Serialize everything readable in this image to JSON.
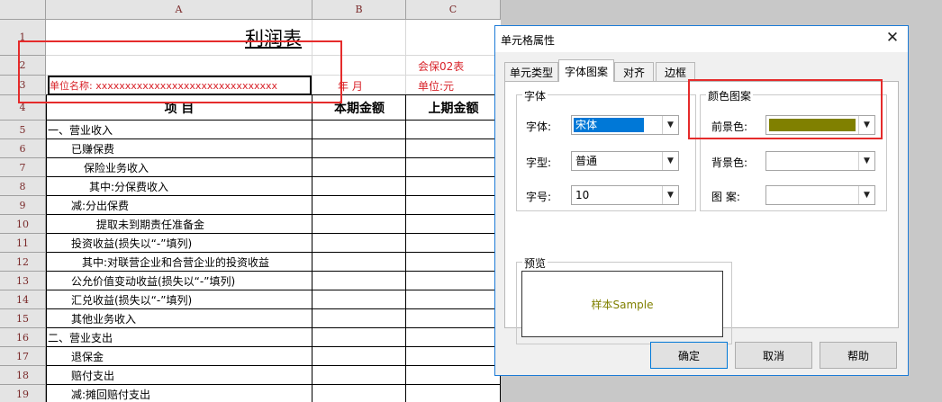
{
  "sheet": {
    "columns": [
      "A",
      "B",
      "C"
    ],
    "rows": [
      "1",
      "2",
      "3",
      "4",
      "5",
      "6",
      "7",
      "8",
      "9",
      "10",
      "11",
      "12",
      "13",
      "14",
      "15",
      "16",
      "17",
      "18",
      "19"
    ],
    "title": "利润表",
    "form_code": "会保02表",
    "unit_name": "单位名称: xxxxxxxxxxxxxxxxxxxxxxxxxxxxxxx",
    "year_month": "年    月",
    "unit": "单位:元",
    "header_item": "项            目",
    "header_current": "本期金额",
    "header_previous": "上期金额",
    "items": [
      "一、营业收入",
      "已赚保费",
      "保险业务收入",
      "其中:分保费收入",
      "减:分出保费",
      "提取未到期责任准备金",
      "投资收益(损失以“-”填列)",
      "其中:对联营企业和合营企业的投资收益",
      "公允价值变动收益(损失以“-”填列)",
      "汇兑收益(损失以“-”填列)",
      "其他业务收入",
      "二、营业支出",
      "退保金",
      "赔付支出",
      "减:摊回赔付支出"
    ]
  },
  "dialog": {
    "title": "单元格属性",
    "close_icon": "close-icon",
    "tabs": [
      "单元类型",
      "字体图案",
      "对齐",
      "边框"
    ],
    "active_tab": "字体图案",
    "font_group": {
      "label": "字体",
      "font_label": "字体:",
      "font_value": "宋体",
      "style_label": "字型:",
      "style_value": "普通",
      "size_label": "字号:",
      "size_value": "10"
    },
    "color_group": {
      "label": "颜色图案",
      "foreground_label": "前景色:",
      "foreground_color": "#808000",
      "background_label": "背景色:",
      "pattern_label": "图  案:"
    },
    "preview": {
      "label": "预览",
      "sample": "样本Sample"
    },
    "buttons": {
      "ok": "确定",
      "cancel": "取消",
      "help": "帮助"
    }
  },
  "colors": {
    "annotation": "#e52b2b",
    "dialog_border": "#1c7bd7",
    "selection": "#0078d7",
    "red_text": "#d8232a"
  }
}
